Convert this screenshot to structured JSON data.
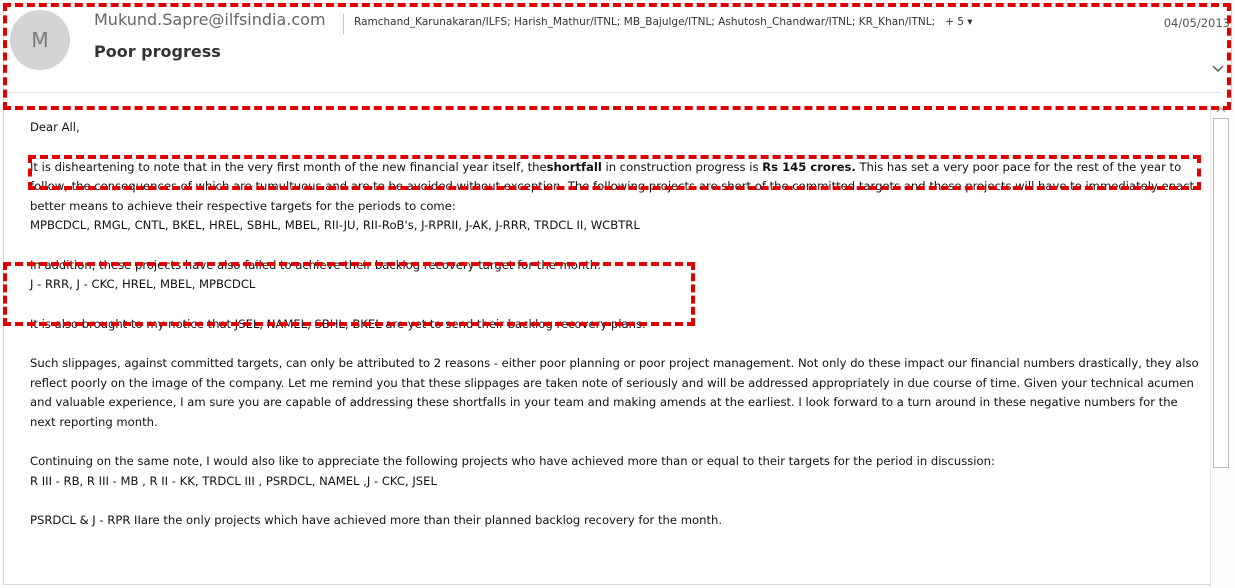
{
  "header": {
    "avatar_initial": "M",
    "sender": "Mukund.Sapre@ilfsindia.com",
    "subject": "Poor progress",
    "recipients": "Ramchand_Karunakaran/ILFS; Harish_Mathur/ITNL; MB_Bajulge/ITNL; Ashutosh_Chandwar/ITNL; KR_Khan/ITNL;",
    "more_recipients": "+ 5 ▾",
    "date": "04/05/2013",
    "expand_icon": "chevron-down-icon"
  },
  "body": {
    "greeting": "Dear All,",
    "p1_part1": "It is disheartening to note that in the very first month of the new financial year itself, the",
    "p1_bold1": "shortfall",
    "p1_part2": " in construction progress is ",
    "p1_bold2": "Rs 145 crores.",
    "p1_part3": " This has set a very poor pace for the rest of the year to follow, the consequences of which are tumultuous and are to be avoided without exception. The following projects are short of the committed targets and these projects will have to immediately enact better means to achieve their respective targets for the periods to come:",
    "p1_projects": "MPBCDCL, RMGL, CNTL, BKEL, HREL, SBHL, MBEL, RII-JU, RII-RoB's, J-RPRII, J-AK, J-RRR, TRDCL II, WCBTRL",
    "p2_line1": "In addition, these projects have also failed to achieve their backlog recovery target for the month:",
    "p2_line2": "J - RRR, J - CKC, HREL, MBEL, MPBCDCL",
    "p3": "It is also brought to my notice that JSEL, NAMEL, SBHL, BKEL are yet to send their backlog recovery plans.",
    "p4": "Such slippages, against committed targets, can only be attributed to 2 reasons - either poor planning or poor project management. Not only do these impact our financial numbers drastically, they also reflect poorly on the image of the company. Let me remind you that these slippages are taken note of seriously and will be addressed appropriately in due course of time. Given your technical acumen and valuable experience, I am sure you are capable of addressing these shortfalls in your team and making amends at the earliest. I look forward to a turn around in these negative numbers for the next reporting month.",
    "p5_line1": "Continuing on the same note, I would also like to appreciate the following projects who have achieved more than or equal to their targets for the period in discussion:",
    "p5_line2": "R III - RB, R III - MB , R II - KK, TRDCL III , PSRDCL, NAMEL ,J - CKC, JSEL",
    "p6": "PSRDCL & J - RPR IIare the only projects which have achieved more than their planned backlog recovery for the month."
  },
  "colors": {
    "annotation": "#e00000",
    "avatar_bg": "#d3d3d3"
  }
}
